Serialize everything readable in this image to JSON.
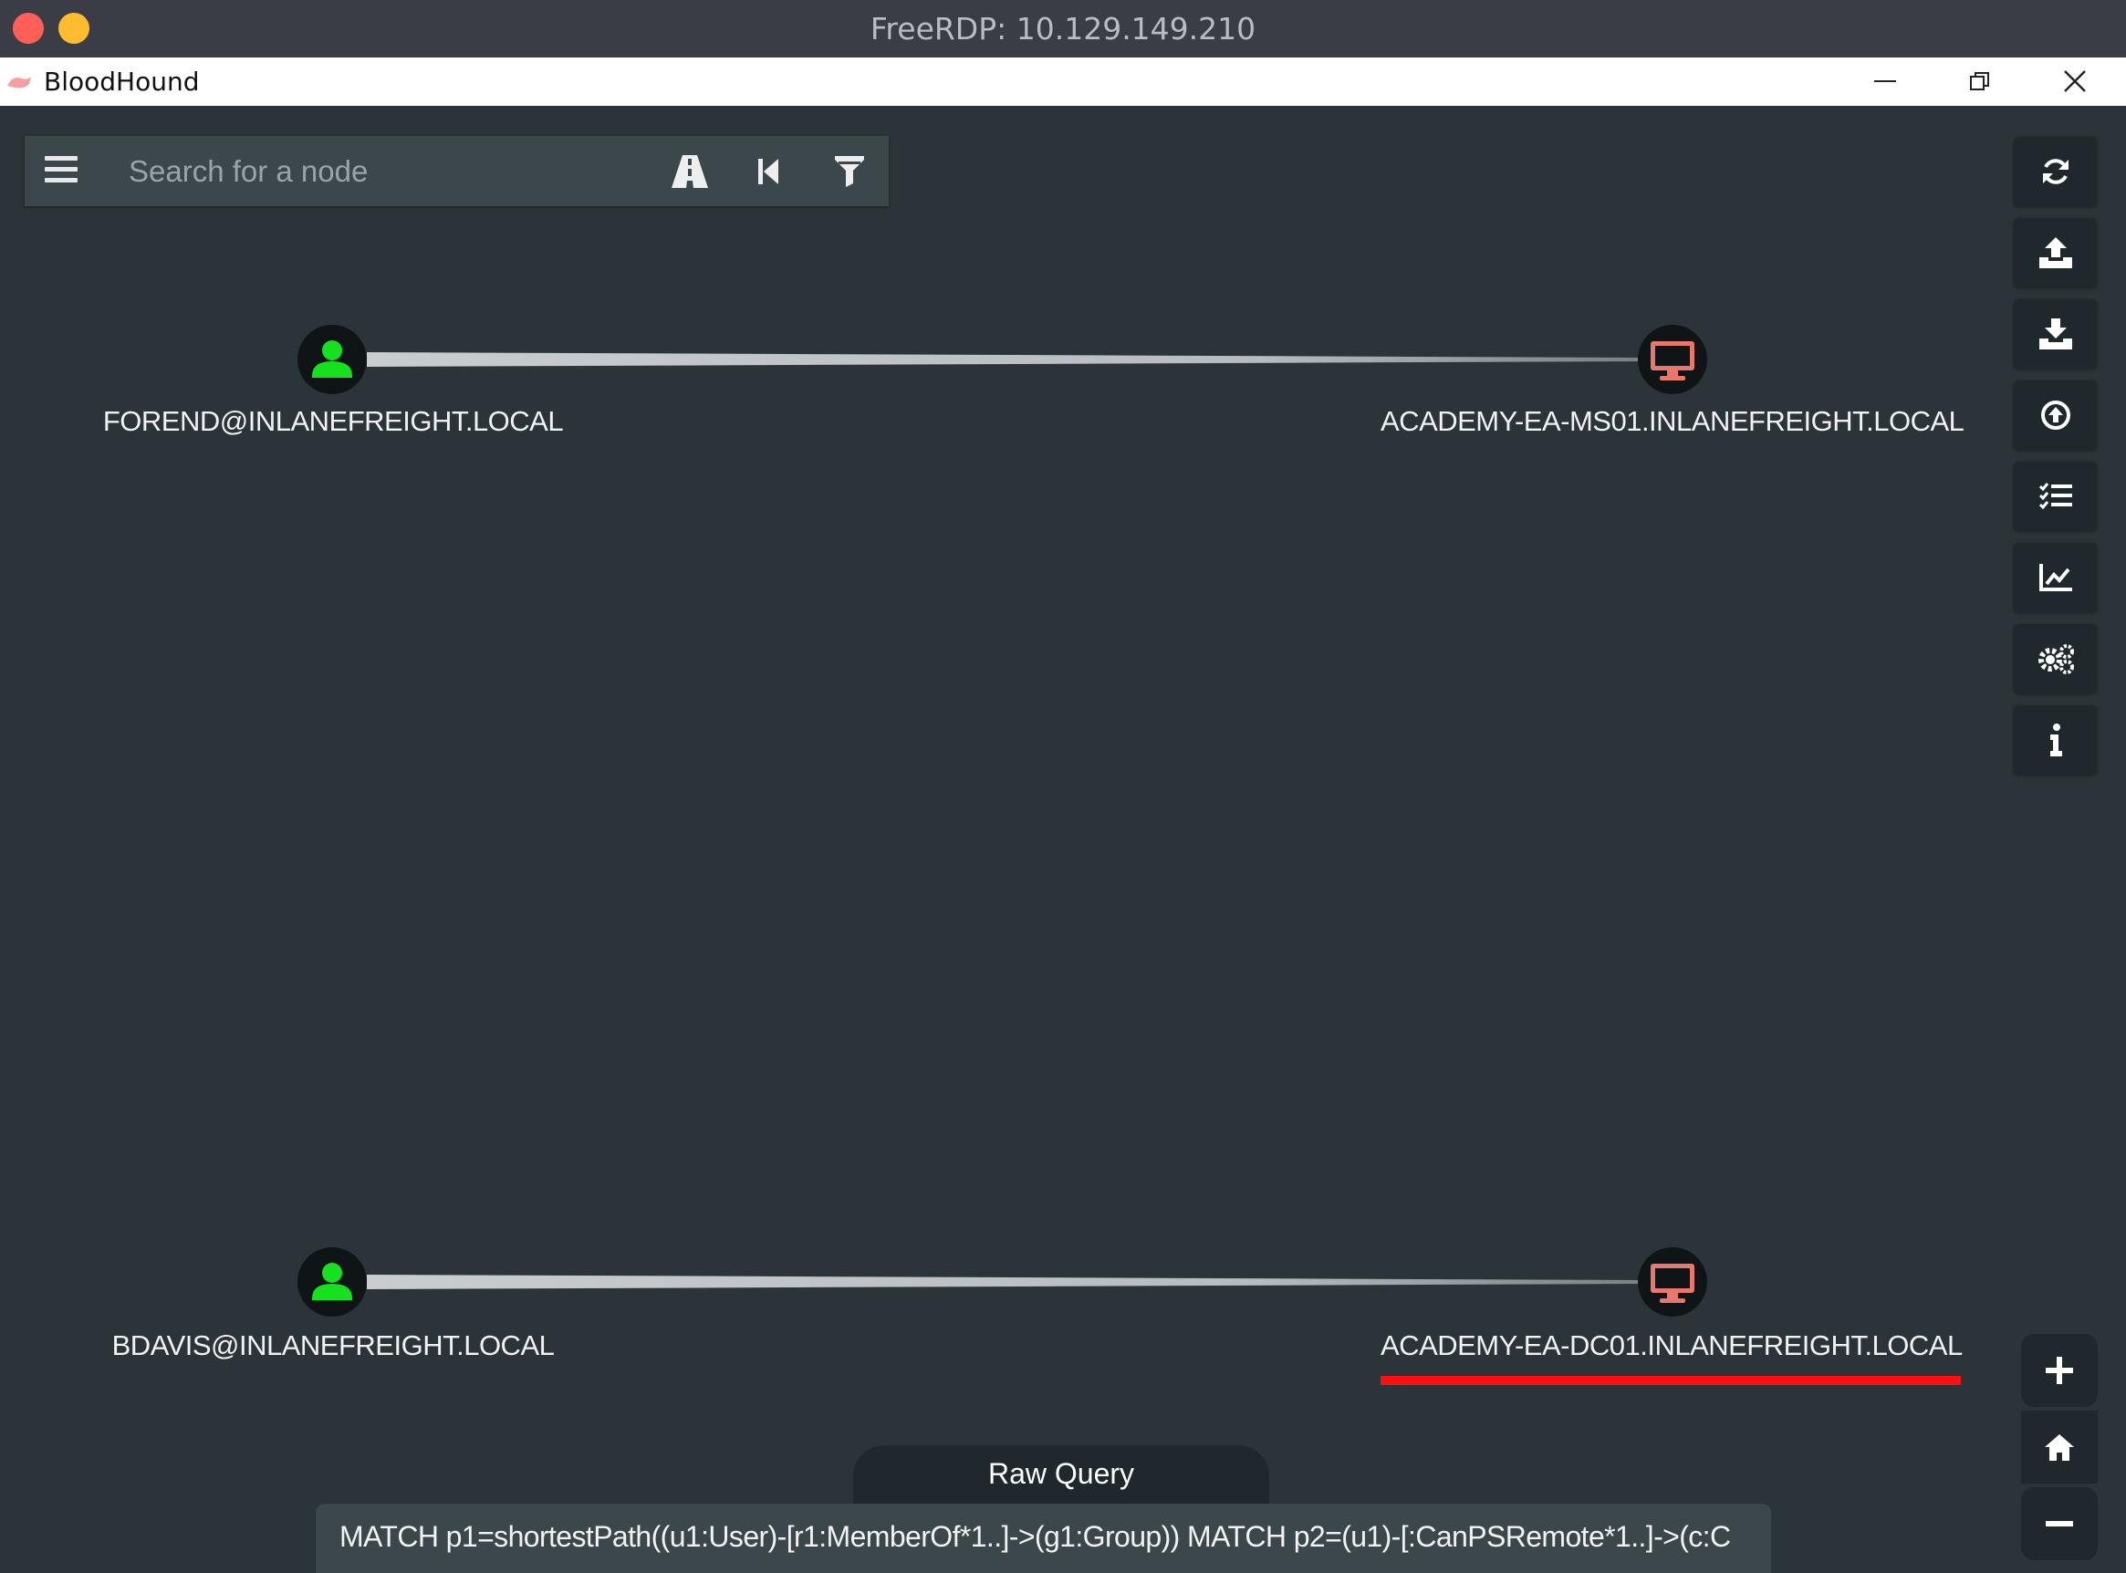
{
  "outer_window": {
    "title": "FreeRDP: 10.129.149.210"
  },
  "app": {
    "name": "BloodHound"
  },
  "search": {
    "placeholder": "Search for a node"
  },
  "toolbar": {
    "icons": [
      "refresh-icon",
      "upload-icon",
      "download-icon",
      "up-circle-icon",
      "list-icon",
      "chart-icon",
      "settings-icon",
      "info-icon"
    ]
  },
  "zoom": {
    "icons": [
      "zoom-in-icon",
      "home-icon",
      "zoom-out-icon"
    ]
  },
  "graph": {
    "nodes": [
      {
        "label": "FOREND@INLANEFREIGHT.LOCAL",
        "type": "user",
        "color": "#17e01e"
      },
      {
        "label": "ACADEMY-EA-MS01.INLANEFREIGHT.LOCAL",
        "type": "computer",
        "color": "#e9776b"
      },
      {
        "label": "BDAVIS@INLANEFREIGHT.LOCAL",
        "type": "user",
        "color": "#17e01e"
      },
      {
        "label": "ACADEMY-EA-DC01.INLANEFREIGHT.LOCAL",
        "type": "computer",
        "color": "#e9776b"
      }
    ]
  },
  "raw_query": {
    "tab_label": "Raw Query",
    "text": "MATCH p1=shortestPath((u1:User)-[r1:MemberOf*1..]->(g1:Group)) MATCH p2=(u1)-[:CanPSRemote*1..]->(c:C"
  }
}
